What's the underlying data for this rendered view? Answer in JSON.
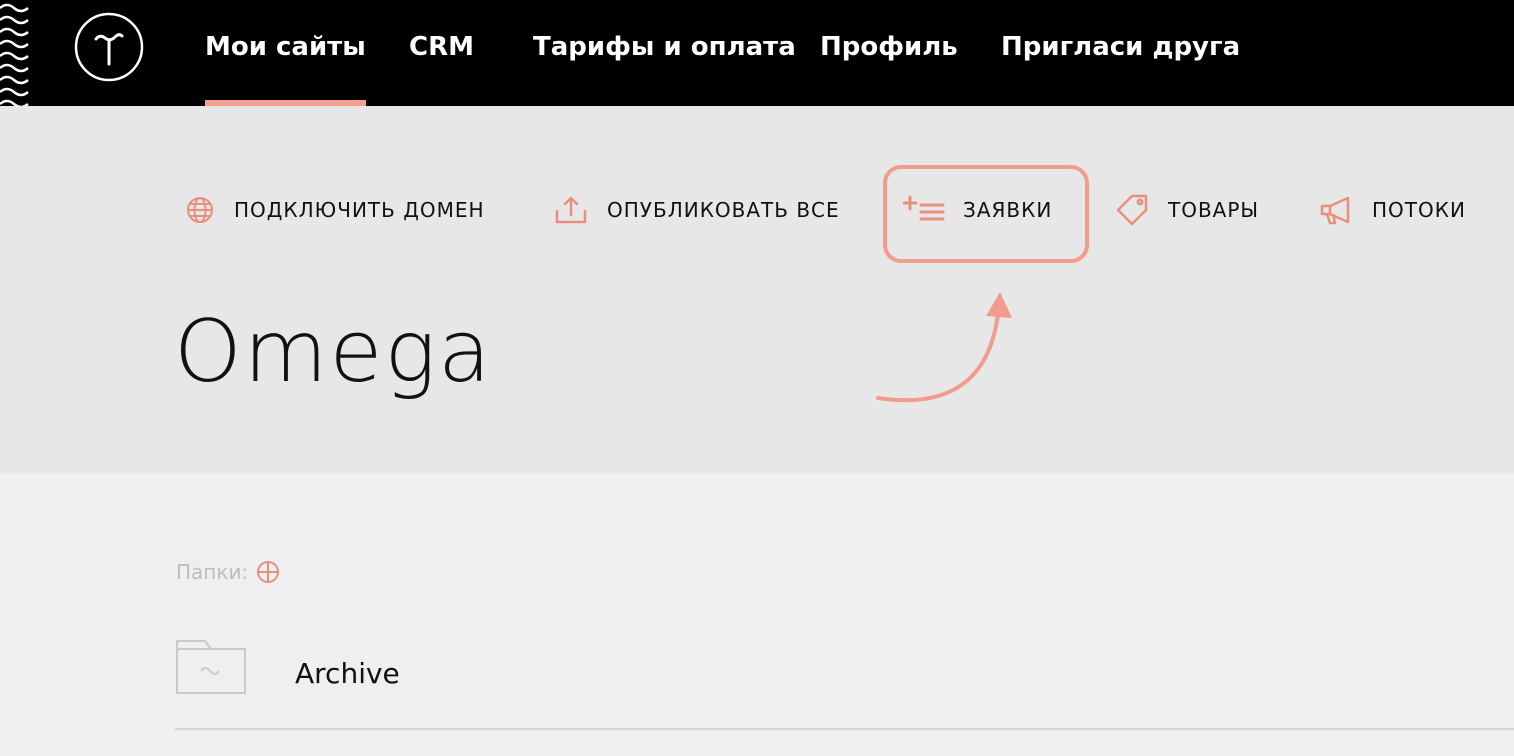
{
  "nav": {
    "items": [
      {
        "label": "Мои сайты",
        "active": true
      },
      {
        "label": "CRM",
        "active": false
      },
      {
        "label": "Тарифы и оплата",
        "active": false
      },
      {
        "label": "Профиль",
        "active": false
      },
      {
        "label": "Пригласи друга",
        "active": false
      }
    ]
  },
  "actions": [
    {
      "label": "ПОДКЛЮЧИТЬ ДОМЕН",
      "icon": "globe-icon"
    },
    {
      "label": "ОПУБЛИКОВАТЬ ВСЕ",
      "icon": "upload-icon"
    },
    {
      "label": "ЗАЯВКИ",
      "icon": "add-list-icon"
    },
    {
      "label": "ТОВАРЫ",
      "icon": "tag-icon"
    },
    {
      "label": "ПОТОКИ",
      "icon": "megaphone-icon"
    }
  ],
  "site": {
    "title": "Omega"
  },
  "folders": {
    "label": "Папки:",
    "items": [
      {
        "name": "Archive"
      }
    ]
  },
  "colors": {
    "accent": "#f19c8c",
    "nav_bg": "#000000",
    "hero_bg": "#e7e7e7",
    "page_bg": "#efefef"
  }
}
